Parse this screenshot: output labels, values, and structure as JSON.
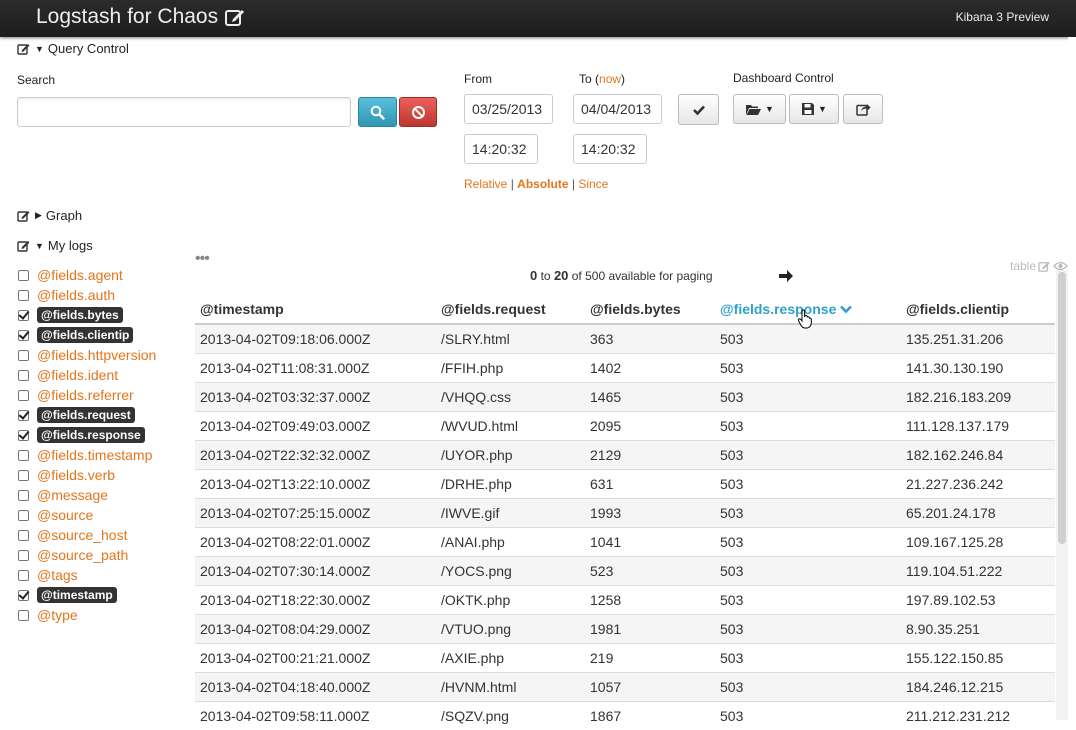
{
  "navbar": {
    "title": "Logstash for Chaos",
    "right_label": "Kibana 3 Preview"
  },
  "query_panel": {
    "title": "Query Control",
    "search_label": "Search",
    "search_value": "",
    "from_label": "From",
    "to_label": "To",
    "to_now_link": "now",
    "from_date": "03/25/2013",
    "from_time": "14:20:32",
    "to_date": "04/04/2013",
    "to_time": "14:20:32",
    "dashboard_control_label": "Dashboard Control",
    "time_modes": {
      "relative": "Relative",
      "absolute": "Absolute",
      "since": "Since",
      "sep": "|"
    }
  },
  "graph_panel": {
    "title": "Graph"
  },
  "logs_panel": {
    "title": "My logs",
    "fields": [
      {
        "name": "@fields.agent",
        "checked": false
      },
      {
        "name": "@fields.auth",
        "checked": false
      },
      {
        "name": "@fields.bytes",
        "checked": true
      },
      {
        "name": "@fields.clientip",
        "checked": true
      },
      {
        "name": "@fields.httpversion",
        "checked": false
      },
      {
        "name": "@fields.ident",
        "checked": false
      },
      {
        "name": "@fields.referrer",
        "checked": false
      },
      {
        "name": "@fields.request",
        "checked": true
      },
      {
        "name": "@fields.response",
        "checked": true
      },
      {
        "name": "@fields.timestamp",
        "checked": false
      },
      {
        "name": "@fields.verb",
        "checked": false
      },
      {
        "name": "@message",
        "checked": false
      },
      {
        "name": "@source",
        "checked": false
      },
      {
        "name": "@source_host",
        "checked": false
      },
      {
        "name": "@source_path",
        "checked": false
      },
      {
        "name": "@tags",
        "checked": false
      },
      {
        "name": "@timestamp",
        "checked": true
      },
      {
        "name": "@type",
        "checked": false
      }
    ],
    "pager": {
      "from": "0",
      "to_word": "to",
      "to": "20",
      "rest": "of 500 available for paging"
    },
    "table_tag": "table",
    "columns": [
      "@timestamp",
      "@fields.request",
      "@fields.bytes",
      "@fields.response",
      "@fields.clientip"
    ],
    "sorted_column": 3,
    "rows": [
      [
        "2013-04-02T09:18:06.000Z",
        "/SLRY.html",
        "363",
        "503",
        "135.251.31.206"
      ],
      [
        "2013-04-02T11:08:31.000Z",
        "/FFIH.php",
        "1402",
        "503",
        "141.30.130.190"
      ],
      [
        "2013-04-02T03:32:37.000Z",
        "/VHQQ.css",
        "1465",
        "503",
        "182.216.183.209"
      ],
      [
        "2013-04-02T09:49:03.000Z",
        "/WVUD.html",
        "2095",
        "503",
        "111.128.137.179"
      ],
      [
        "2013-04-02T22:32:32.000Z",
        "/UYOR.php",
        "2129",
        "503",
        "182.162.246.84"
      ],
      [
        "2013-04-02T13:22:10.000Z",
        "/DRHE.php",
        "631",
        "503",
        "21.227.236.242"
      ],
      [
        "2013-04-02T07:25:15.000Z",
        "/IWVE.gif",
        "1993",
        "503",
        "65.201.24.178"
      ],
      [
        "2013-04-02T08:22:01.000Z",
        "/ANAI.php",
        "1041",
        "503",
        "109.167.125.28"
      ],
      [
        "2013-04-02T07:30:14.000Z",
        "/YOCS.png",
        "523",
        "503",
        "119.104.51.222"
      ],
      [
        "2013-04-02T18:22:30.000Z",
        "/OKTK.php",
        "1258",
        "503",
        "197.89.102.53"
      ],
      [
        "2013-04-02T08:04:29.000Z",
        "/VTUO.png",
        "1981",
        "503",
        "8.90.35.251"
      ],
      [
        "2013-04-02T00:21:21.000Z",
        "/AXIE.php",
        "219",
        "503",
        "155.122.150.85"
      ],
      [
        "2013-04-02T04:18:40.000Z",
        "/HVNM.html",
        "1057",
        "503",
        "184.246.12.215"
      ],
      [
        "2013-04-02T09:58:11.000Z",
        "/SQZV.png",
        "1867",
        "503",
        "211.212.231.212"
      ]
    ]
  },
  "colors": {
    "link": "#e3751c",
    "sorted_header": "#2ea2cc",
    "navbar": "#222222"
  }
}
